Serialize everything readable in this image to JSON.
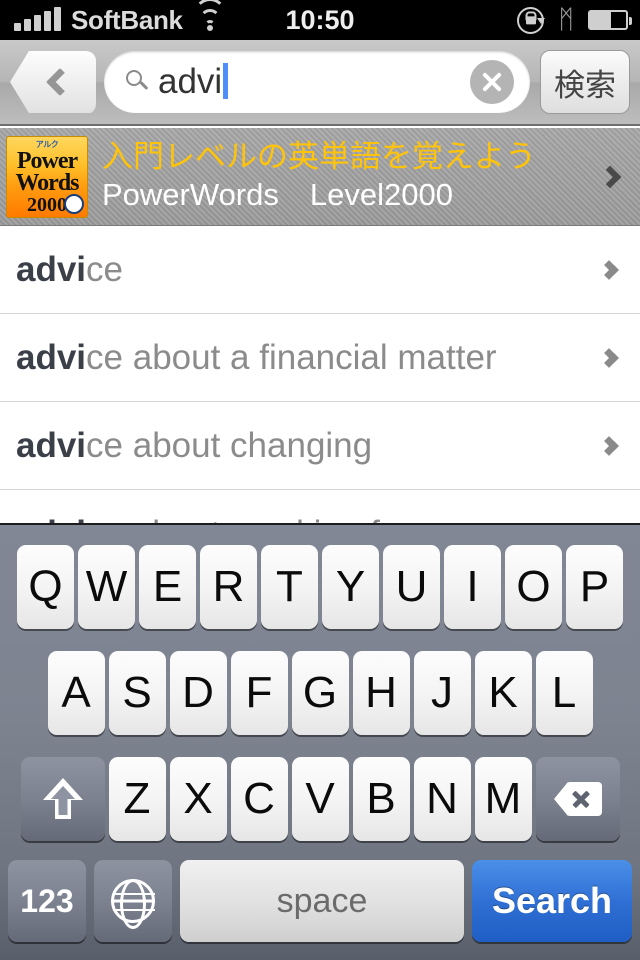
{
  "status_bar": {
    "carrier": "SoftBank",
    "time": "10:50",
    "signal_bars": 5,
    "wifi_icon": "wifi-icon",
    "rotation_lock_icon": "rotation-lock-icon",
    "bluetooth_icon": "bluetooth-icon",
    "bluetooth_glyph": "ᛗ",
    "battery_icon": "battery-icon",
    "battery_level_percent": 58
  },
  "search_bar": {
    "back_label": "",
    "back_icon": "chevron-left-icon",
    "search_icon": "magnifier-icon",
    "query_value": "advi",
    "query_placeholder": "",
    "clear_icon": "clear-circle-icon",
    "search_button_label": "検索"
  },
  "banner": {
    "icon": {
      "brand": "アルク",
      "line1": "Power",
      "line2": "Words",
      "line3": "2000",
      "mascot": "mascot-icon"
    },
    "title": "入門レベルの英単語を覚えよう",
    "subtitle": "PowerWords　Level2000",
    "chevron_icon": "chevron-right-icon",
    "title_color": "#ffc40a",
    "subtitle_color": "#ffffff"
  },
  "suggestions": [
    {
      "match": "advi",
      "rest": "ce"
    },
    {
      "match": "advi",
      "rest": "ce about a financial matter"
    },
    {
      "match": "advi",
      "rest": "ce about changing"
    },
    {
      "match": "advi",
      "rest": "ce about smoking for ..."
    }
  ],
  "keyboard": {
    "row1": [
      "Q",
      "W",
      "E",
      "R",
      "T",
      "Y",
      "U",
      "I",
      "O",
      "P"
    ],
    "row2": [
      "A",
      "S",
      "D",
      "F",
      "G",
      "H",
      "J",
      "K",
      "L"
    ],
    "row3": [
      "Z",
      "X",
      "C",
      "V",
      "B",
      "N",
      "M"
    ],
    "shift_icon": "shift-icon",
    "delete_icon": "delete-backspace-icon",
    "numeric_label": "123",
    "globe_icon": "globe-icon",
    "space_label": "space",
    "return_label": "Search",
    "return_key_color": "#2f6fd4"
  }
}
